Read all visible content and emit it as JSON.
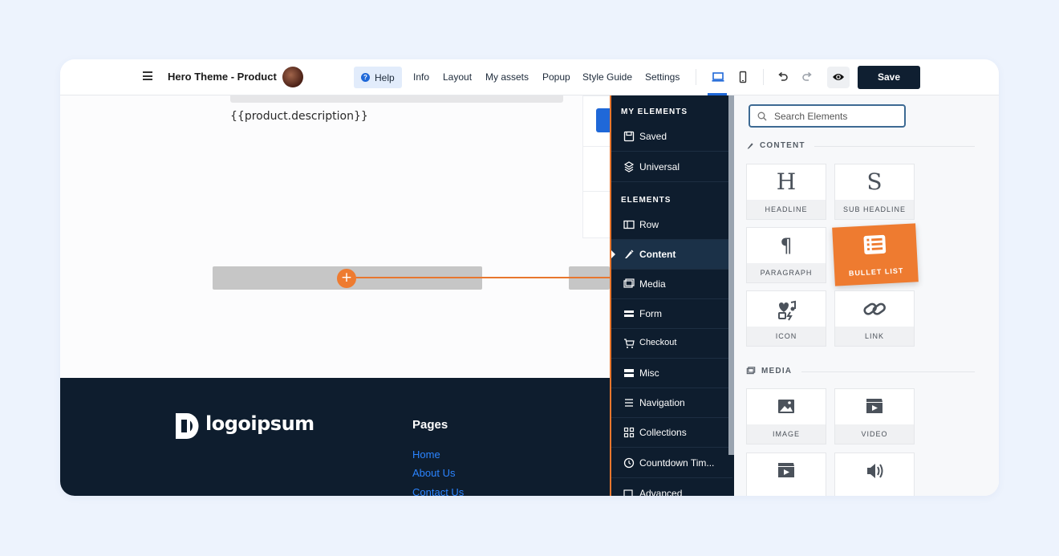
{
  "header": {
    "app_title": "Hero Theme - Product",
    "help_label": "Help",
    "help_glyph": "?",
    "nav": [
      "Info",
      "Layout",
      "My assets",
      "Popup",
      "Style Guide",
      "Settings"
    ],
    "save_label": "Save"
  },
  "canvas": {
    "description_placeholder": "{{product.description}}",
    "plus_glyph": "+"
  },
  "footer": {
    "logo_text": "logoipsum",
    "pages_heading": "Pages",
    "links": [
      "Home",
      "About Us",
      "Contact Us"
    ]
  },
  "sidebar": {
    "my_elements_heading": "MY ELEMENTS",
    "my_elements": [
      {
        "label": "Saved",
        "icon": "save-icon"
      },
      {
        "label": "Universal",
        "icon": "universal-icon"
      }
    ],
    "elements_heading": "ELEMENTS",
    "elements": [
      {
        "label": "Row",
        "icon": "row-icon"
      },
      {
        "label": "Content",
        "icon": "content-icon",
        "active": true
      },
      {
        "label": "Media",
        "icon": "media-icon"
      },
      {
        "label": "Form",
        "icon": "form-icon"
      },
      {
        "label": "Checkout",
        "icon": "checkout-icon"
      },
      {
        "label": "Misc",
        "icon": "misc-icon"
      },
      {
        "label": "Navigation",
        "icon": "navigation-icon"
      },
      {
        "label": "Collections",
        "icon": "collections-icon"
      },
      {
        "label": "Countdown Tim...",
        "icon": "countdown-icon"
      },
      {
        "label": "Advanced",
        "icon": "advanced-icon"
      }
    ]
  },
  "panel": {
    "search_placeholder": "Search Elements",
    "content_heading": "CONTENT",
    "content_tiles": [
      {
        "label": "HEADLINE",
        "icon": "headline-icon",
        "glyph": "H"
      },
      {
        "label": "SUB HEADLINE",
        "icon": "sub-headline-icon",
        "glyph": "S"
      },
      {
        "label": "PARAGRAPH",
        "icon": "paragraph-icon",
        "glyph": "¶"
      },
      {
        "label": "BULLET LIST",
        "icon": "bullet-list-icon",
        "dragging": true
      },
      {
        "label": "ICON",
        "icon": "icon-icon"
      },
      {
        "label": "LINK",
        "icon": "link-icon"
      }
    ],
    "media_heading": "MEDIA",
    "media_tiles": [
      {
        "label": "IMAGE",
        "icon": "image-icon"
      },
      {
        "label": "VIDEO",
        "icon": "video-icon"
      },
      {
        "label": "",
        "icon": "video-icon"
      },
      {
        "label": "",
        "icon": "audio-icon"
      }
    ]
  },
  "colors": {
    "accent_orange": "#ee7b30",
    "primary_blue": "#1f68d8",
    "dark_navy": "#0e1d2e",
    "footer_link_blue": "#2b84ff"
  }
}
